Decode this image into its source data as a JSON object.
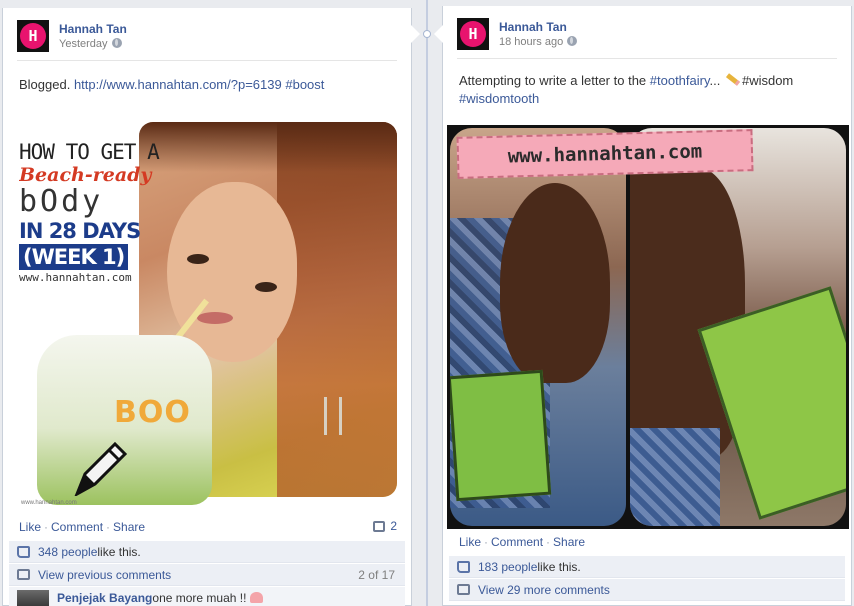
{
  "posts": [
    {
      "author": "Hannah Tan",
      "timestamp": "Yesterday",
      "text_prefix": "Blogged. ",
      "link": "http://www.hannahtan.com/?p=6139",
      "hashtag": "#boost",
      "image": {
        "title_line1": "HOW TO GET A",
        "title_line2": "Beach-ready",
        "title_line3": "bOdy",
        "title_line4": "IN 28 DAYS",
        "title_line5": "(WEEK 1)",
        "title_line6": "www.hannahtan.com",
        "cup_text": "BOO",
        "small_url": "www.hannahtan.com"
      },
      "actions": {
        "like": "Like",
        "comment": "Comment",
        "share": "Share"
      },
      "comment_count": "2",
      "likes_link": "348 people",
      "likes_suffix": " like this.",
      "view_previous": "View previous comments",
      "pagination": "2 of 17",
      "comment_author": "Penjejak Bayang",
      "comment_text": " one more muah !!"
    },
    {
      "author": "Hannah Tan",
      "timestamp": "18 hours ago",
      "text_prefix": "Attempting to write a letter to the ",
      "hashtag1": "#toothfairy",
      "text_mid": "... ",
      "hashtag2": "#wisdom",
      "hashtag3": "#wisdomtooth",
      "image": {
        "banner": "www.hannahtan.com"
      },
      "actions": {
        "like": "Like",
        "comment": "Comment",
        "share": "Share"
      },
      "likes_link": "183 people",
      "likes_suffix": " like this.",
      "view_more": "View 29 more comments"
    }
  ],
  "colors": {
    "link": "#3b5998",
    "ufi_bg": "#eceff5",
    "avatar_pink": "#e8136e"
  }
}
